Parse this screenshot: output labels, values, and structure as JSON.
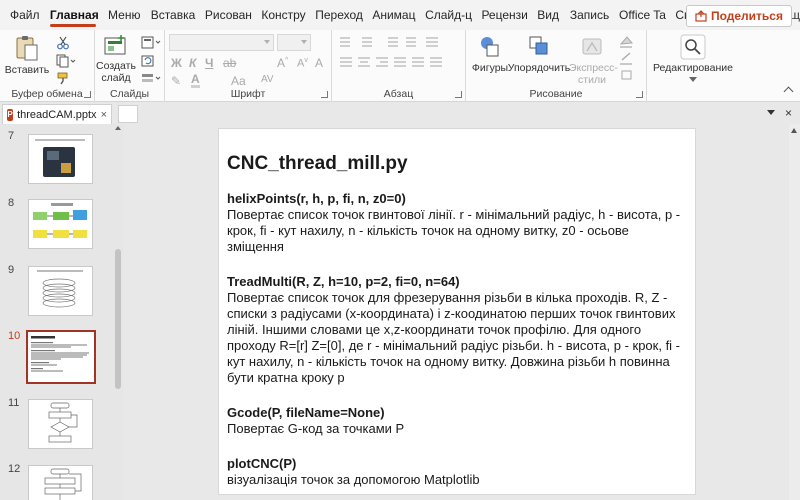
{
  "ribbon_tabs": [
    {
      "label": "Файл"
    },
    {
      "label": "Главная"
    },
    {
      "label": "Меню"
    },
    {
      "label": "Вставка"
    },
    {
      "label": "Рисован"
    },
    {
      "label": "Констру"
    },
    {
      "label": "Переход"
    },
    {
      "label": "Анимац"
    },
    {
      "label": "Слайд-ц"
    },
    {
      "label": "Рецензи"
    },
    {
      "label": "Вид"
    },
    {
      "label": "Запись"
    },
    {
      "label": "Office Ta"
    },
    {
      "label": "Справка"
    }
  ],
  "help_label": "Помощ",
  "share_label": "Поделиться",
  "ribbon": {
    "paste_label": "Вставить",
    "clipboard_group": "Буфер обмена",
    "new_slide_label": "Создать слайд",
    "slides_group": "Слайды",
    "font_group": "Шрифт",
    "paragraph_group": "Абзац",
    "shapes_label": "Фигуры",
    "arrange_label": "Упорядочить",
    "express_styles_label": "Экспресс-стили",
    "drawing_group": "Рисование",
    "editing_label": "Редактирование"
  },
  "document_tab": {
    "name": "threadCAM.pptx",
    "close": "×"
  },
  "thumbnails": [
    {
      "number": "7"
    },
    {
      "number": "8"
    },
    {
      "number": "9"
    },
    {
      "number": "10"
    },
    {
      "number": "11"
    },
    {
      "number": "12"
    }
  ],
  "slide": {
    "title": "CNC_thread_mill.py",
    "functions": [
      {
        "name": "helixPoints(r, h, p, fi, n, z0=0)",
        "description": "Повертає список точок гвинтової лінії. r - мінімальний радіус, h - висота, p - крок, fi - кут нахилу, n - кількість точок на одному витку, z0 - осьове зміщення"
      },
      {
        "name": "TreadMulti(R, Z, h=10, p=2, fi=0, n=64)",
        "description": "Повертає список точок для фрезерування різьби в кілька проходів. R, Z - списки з радіусами (x-координата) і z-коодинатою перших точок гвинтових ліній. Іншими словами це x,z-координати точок профілю. Для одного проходу R=[r] Z=[0], де r - мінімальний радіус різьби. h - висота, p - крок, fi - кут нахилу, n - кількість точок на одному витку. Довжина різьби h повинна бути кратна кроку p"
      },
      {
        "name": "Gcode(P, fileName=None)",
        "description": "Повертає G-код за точками P"
      },
      {
        "name": "plotCNC(P)",
        "description": "візуалізація точок за допомогою Matplotlib"
      }
    ]
  }
}
